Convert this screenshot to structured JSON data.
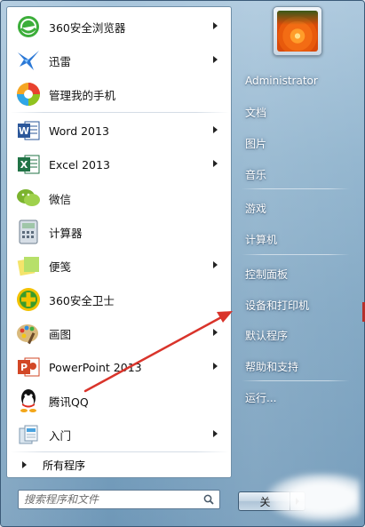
{
  "programs": [
    {
      "label": "360安全浏览器",
      "has_arrow": true,
      "icon": "360-browser-icon"
    },
    {
      "label": "迅雷",
      "has_arrow": true,
      "icon": "xunlei-icon"
    },
    {
      "label": "管理我的手机",
      "has_arrow": false,
      "icon": "phone-manager-icon"
    },
    {
      "label": "Word 2013",
      "has_arrow": true,
      "icon": "word-icon"
    },
    {
      "label": "Excel 2013",
      "has_arrow": true,
      "icon": "excel-icon"
    },
    {
      "label": "微信",
      "has_arrow": false,
      "icon": "wechat-icon"
    },
    {
      "label": "计算器",
      "has_arrow": false,
      "icon": "calculator-icon"
    },
    {
      "label": "便笺",
      "has_arrow": true,
      "icon": "sticky-notes-icon"
    },
    {
      "label": "360安全卫士",
      "has_arrow": false,
      "icon": "360-security-icon"
    },
    {
      "label": "画图",
      "has_arrow": true,
      "icon": "paint-icon"
    },
    {
      "label": "PowerPoint 2013",
      "has_arrow": true,
      "icon": "powerpoint-icon"
    },
    {
      "label": "腾讯QQ",
      "has_arrow": false,
      "icon": "qq-icon"
    },
    {
      "label": "入门",
      "has_arrow": true,
      "icon": "getting-started-icon"
    }
  ],
  "all_programs_label": "所有程序",
  "search": {
    "placeholder": "搜索程序和文件"
  },
  "right_links": [
    "Administrator",
    "文档",
    "图片",
    "音乐",
    "游戏",
    "计算机",
    "控制面板",
    "设备和打印机",
    "默认程序",
    "帮助和支持",
    "运行..."
  ],
  "shutdown_label": "关",
  "colors": {
    "annotation_arrow": "#d9342b",
    "glass": "#8fb3cd"
  }
}
